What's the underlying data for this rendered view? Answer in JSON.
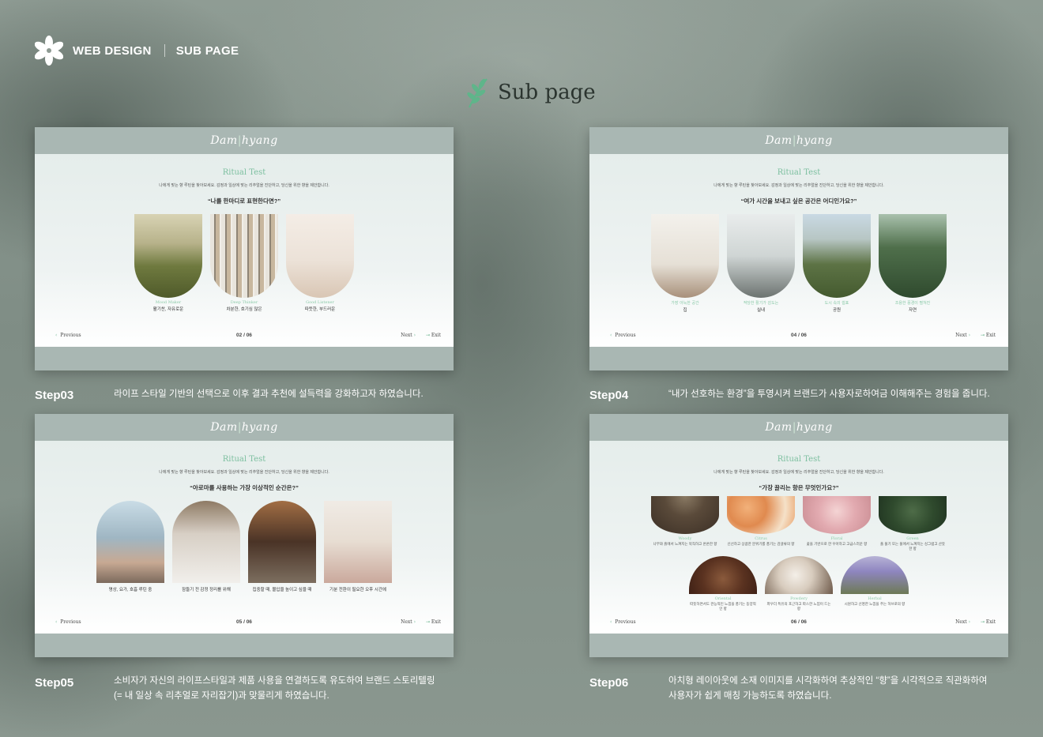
{
  "header": {
    "section": "WEB DESIGN",
    "sub": "SUB PAGE"
  },
  "title": "Sub page",
  "logo": {
    "a": "Dam",
    "b": "hyang"
  },
  "colors": {
    "accent": "#7cbf9f",
    "panel_bar": "#a9b7b3"
  },
  "panels": [
    {
      "ritual": "Ritual Test",
      "desc": "나에게 맞는 향 루틴을 찾아보세요. 감정과 일상에 맞는 리추얼을 진단하고, 당신을 위한 향을 제안합니다.",
      "question": "“나를 한마디로 표현한다면?”",
      "options": [
        {
          "en": "Mood Maker",
          "ko": "활기찬, 자유로운"
        },
        {
          "en": "Deep Thinker",
          "ko": "차분한, 호기심 많은"
        },
        {
          "en": "Good Listener",
          "ko": "따뜻한, 부드러운"
        }
      ],
      "nav": {
        "prev": "Previous",
        "page": "02 / 06",
        "next": "Next",
        "exit": "Exit"
      },
      "step": "Step03",
      "step_desc": [
        "라이프 스타일 기반의 선택으로 이후 결과 추천에 설득력을 강화하고자 하였습니다."
      ]
    },
    {
      "ritual": "Ritual Test",
      "desc": "나에게 맞는 향 루틴을 찾아보세요. 감정과 일상에 맞는 리추얼을 진단하고, 당신을 위한 향을 제안합니다.",
      "question": "“여가 시간을 보내고 싶은 공간은 어디인가요?”",
      "options": [
        {
          "en": "가장 아늑한 공간",
          "ko": "집"
        },
        {
          "en": "적당한 활기가 감도는",
          "ko": "실내"
        },
        {
          "en": "도시 속의 쉼표",
          "ko": "공원"
        },
        {
          "en": "조용한 풍경이 펼쳐진",
          "ko": "자연"
        }
      ],
      "nav": {
        "prev": "Previous",
        "page": "04 / 06",
        "next": "Next",
        "exit": "Exit"
      },
      "step": "Step04",
      "step_desc": [
        "“내가 선호하는 환경”을 투영시켜 브랜드가 사용자로하여금 이해해주는 경험을 줍니다."
      ]
    },
    {
      "ritual": "Ritual Test",
      "desc": "나에게 맞는 향 루틴을 찾아보세요. 감정과 일상에 맞는 리추얼을 진단하고, 당신을 위한 향을 제안합니다.",
      "question": "“아로마를 사용하는 가장 이상적인 순간은?”",
      "options": [
        {
          "ko": "명상, 요가, 호흡 루틴 중"
        },
        {
          "ko": "잠들기 전 감정 정리를 위해"
        },
        {
          "ko": "집중할 때, 몰입을 높이고 싶을 때"
        },
        {
          "ko": "기분 전환이 필요한 오후 시간에"
        }
      ],
      "nav": {
        "prev": "Previous",
        "page": "05 / 06",
        "next": "Next",
        "exit": "Exit"
      },
      "step": "Step05",
      "step_desc": [
        "소비자가 자신의 라이프스타일과 제품 사용을 연결하도록 유도하여 브랜드 스토리텔링",
        "(= 내 일상 속 리추얼로 자리잡기)과 맞물리게 하였습니다."
      ]
    },
    {
      "ritual": "Ritual Test",
      "desc": "나에게 맞는 향 루틴을 찾아보세요. 감정과 일상에 맞는 리추얼을 진단하고, 당신을 위한 향을 제안합니다.",
      "question": "“가장 끌리는 향은 무엇인가요?”",
      "options": [
        {
          "en": "Woody",
          "ko": "나무와 흙에서 느껴지는 묵직하고 온온한 향"
        },
        {
          "en": "Citrus",
          "ko": "신선하고 상큼한 분위기를 풍기는 감귤류의 향"
        },
        {
          "en": "Floral",
          "ko": "꽃을 기반으로 한 우아하고 고급스러운 향"
        },
        {
          "en": "Green",
          "ko": "풀 풀기 또는 풀에서 느껴지는 싱그럽고 산뜻한 향"
        },
        {
          "en": "Oriental",
          "ko": "따뜻하면서도 관능적인 느낌을 풍기는 동양적인 향"
        },
        {
          "en": "Powdery",
          "ko": "파우더 특유의 포근하고 따스한 느낌이 드는 향"
        },
        {
          "en": "Herbal",
          "ko": "시원하고 선명한 느낌을 주는 허브로의 향"
        }
      ],
      "nav": {
        "prev": "Previous",
        "page": "06 / 06",
        "next": "Next",
        "exit": "Exit"
      },
      "step": "Step06",
      "step_desc": [
        "아치형 레이아웃에 소재 이미지를 시각화하여 추상적인 “향”을 시각적으로 직관화하여",
        "사용자가 쉽게 매칭 가능하도록 하였습니다."
      ]
    }
  ]
}
